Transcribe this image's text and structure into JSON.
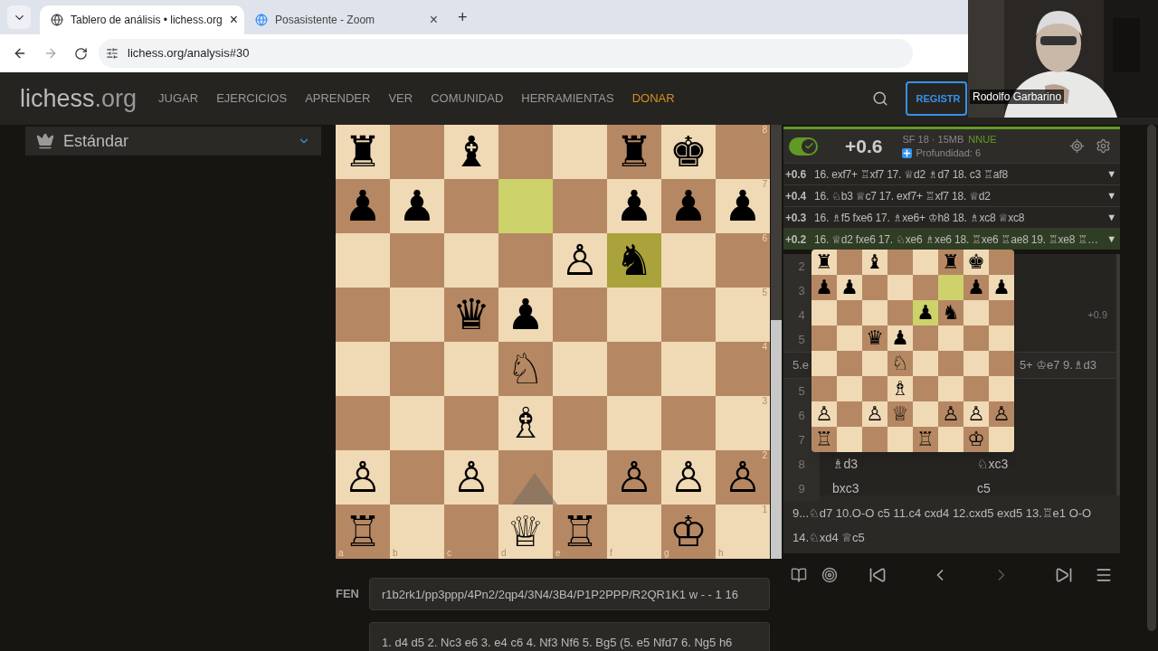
{
  "browser": {
    "tabs": [
      {
        "title": "Tablero de análisis • lichess.org",
        "selected": true,
        "close": "×"
      },
      {
        "title": "Posasistente - Zoom",
        "selected": false,
        "close": "×"
      }
    ],
    "new_tab": "+",
    "url": "lichess.org/analysis#30"
  },
  "header": {
    "logo": "lichess",
    "logo_suffix": ".org",
    "nav": [
      {
        "label": "JUGAR",
        "kind": "plain"
      },
      {
        "label": "EJERCICIOS",
        "kind": "plain"
      },
      {
        "label": "APRENDER",
        "kind": "plain"
      },
      {
        "label": "VER",
        "kind": "plain"
      },
      {
        "label": "COMUNIDAD",
        "kind": "plain"
      },
      {
        "label": "HERRAMIENTAS",
        "kind": "plain"
      },
      {
        "label": "DONAR",
        "kind": "highlight"
      }
    ],
    "register": "REGISTR"
  },
  "webcam": {
    "name": "Rodolfo Garbarino"
  },
  "variant": {
    "label": "Estándar"
  },
  "board": {
    "files": [
      "a",
      "b",
      "c",
      "d",
      "e",
      "f",
      "g",
      "h"
    ],
    "ranks": [
      {
        "label": "8",
        "squares": [
          {
            "piece": "♜",
            "highlight": false
          },
          {
            "highlight": false
          },
          {
            "piece": "♝",
            "highlight": false
          },
          {
            "highlight": false
          },
          {
            "highlight": false
          },
          {
            "piece": "♜",
            "highlight": false
          },
          {
            "piece": "♚",
            "highlight": false
          },
          {
            "highlight": false
          }
        ]
      },
      {
        "label": "7",
        "squares": [
          {
            "piece": "♟",
            "highlight": false
          },
          {
            "piece": "♟",
            "highlight": false
          },
          {
            "highlight": false
          },
          {
            "highlight": true
          },
          {
            "highlight": false
          },
          {
            "piece": "♟",
            "highlight": false
          },
          {
            "piece": "♟",
            "highlight": false
          },
          {
            "piece": "♟",
            "highlight": false
          }
        ]
      },
      {
        "label": "6",
        "squares": [
          {
            "highlight": false
          },
          {
            "highlight": false
          },
          {
            "highlight": false
          },
          {
            "highlight": false
          },
          {
            "piece": "♙",
            "highlight": false
          },
          {
            "piece": "♞",
            "highlight": true
          },
          {
            "highlight": false
          },
          {
            "highlight": false
          }
        ]
      },
      {
        "label": "5",
        "squares": [
          {
            "highlight": false
          },
          {
            "highlight": false
          },
          {
            "piece": "♛",
            "highlight": false
          },
          {
            "piece": "♟",
            "highlight": false
          },
          {
            "highlight": false
          },
          {
            "highlight": false
          },
          {
            "highlight": false
          },
          {
            "highlight": false
          }
        ]
      },
      {
        "label": "4",
        "squares": [
          {
            "highlight": false
          },
          {
            "highlight": false
          },
          {
            "highlight": false
          },
          {
            "piece": "♘",
            "highlight": false
          },
          {
            "highlight": false
          },
          {
            "highlight": false
          },
          {
            "highlight": false
          },
          {
            "highlight": false
          }
        ]
      },
      {
        "label": "3",
        "squares": [
          {
            "highlight": false
          },
          {
            "highlight": false
          },
          {
            "highlight": false
          },
          {
            "piece": "♗",
            "highlight": false
          },
          {
            "highlight": false
          },
          {
            "highlight": false
          },
          {
            "highlight": false
          },
          {
            "highlight": false
          }
        ]
      },
      {
        "label": "2",
        "squares": [
          {
            "piece": "♙",
            "highlight": false
          },
          {
            "highlight": false
          },
          {
            "piece": "♙",
            "highlight": false
          },
          {
            "highlight": false
          },
          {
            "highlight": false
          },
          {
            "piece": "♙",
            "highlight": false
          },
          {
            "piece": "♙",
            "highlight": false
          },
          {
            "piece": "♙",
            "highlight": false
          }
        ]
      },
      {
        "label": "1",
        "squares": [
          {
            "piece": "♖",
            "highlight": false
          },
          {
            "highlight": false
          },
          {
            "highlight": false
          },
          {
            "piece": "♕",
            "highlight": false
          },
          {
            "piece": "♖",
            "highlight": false
          },
          {
            "highlight": false
          },
          {
            "piece": "♔",
            "highlight": false
          },
          {
            "highlight": false
          }
        ]
      }
    ]
  },
  "eval_bar": {
    "level": 0.55
  },
  "fen": {
    "label": "FEN",
    "value": "r1b2rk1/pp3ppp/4Pn2/2qp4/3N4/3B4/P1P2PPP/R2QR1K1 w - - 1 16"
  },
  "pgn": {
    "value": "1. d4 d5 2. Nc3 e6 3. e4 c6 4. Nf3 Nf6 5. Bg5 (5. e5 Nfd7 6. Ng5 h6"
  },
  "engine": {
    "on": true,
    "eval": "+0.6",
    "name": "SF 18 · 15MB",
    "tag": "NNUE",
    "depth": "Profundidad: 6",
    "lines": [
      {
        "eval": "+0.6",
        "moves": "16. exf7+ ♖xf7 17. ♕d2 ♗d7 18. c3 ♖af8",
        "caret": "▼",
        "selected": false
      },
      {
        "eval": "+0.4",
        "moves": "16. ♘b3 ♕c7 17. exf7+ ♖xf7 18. ♕d2",
        "caret": "▼",
        "selected": false
      },
      {
        "eval": "+0.3",
        "moves": "16. ♗f5 fxe6 17. ♗xe6+ ♔h8 18. ♗xc8 ♕xc8",
        "caret": "▼",
        "selected": false
      },
      {
        "eval": "+0.2",
        "moves": "16. ♕d2 fxe6 17. ♘xe6 ♗xe6 18. ♖xe6 ♖ae8 19. ♖xe8 ♖…",
        "caret": "▼",
        "selected": true
      }
    ]
  },
  "moves": {
    "rows": [
      {
        "kind": "move",
        "number": "2"
      },
      {
        "kind": "move",
        "number": "3"
      },
      {
        "kind": "move",
        "number": "4",
        "eval": "+0.9"
      },
      {
        "kind": "move",
        "number": "5"
      },
      {
        "kind": "variation",
        "left": "5.e",
        "right": "5+ ♔e7 9.♗d3"
      },
      {
        "kind": "move",
        "number": "5"
      },
      {
        "kind": "move",
        "number": "6"
      },
      {
        "kind": "move",
        "number": "7"
      },
      {
        "kind": "move",
        "number": "8",
        "white": "♗d3",
        "black": "♘xc3"
      },
      {
        "kind": "move",
        "number": "9",
        "white": "bxc3",
        "black": "c5"
      }
    ],
    "variation": "9...♘d7 10.O-O c5 11.c4 cxd4 12.cxd5 exd5 13.♖e1 O-O 14.♘xd4 ♕c5"
  },
  "preview": {
    "ranks": [
      {
        "squares": [
          {
            "piece": "♜",
            "highlight": false
          },
          {
            "highlight": false
          },
          {
            "piece": "♝",
            "highlight": false
          },
          {
            "highlight": false
          },
          {
            "highlight": false
          },
          {
            "piece": "♜",
            "highlight": false
          },
          {
            "piece": "♚",
            "highlight": false
          },
          {
            "highlight": false
          }
        ]
      },
      {
        "squares": [
          {
            "piece": "♟",
            "highlight": false
          },
          {
            "piece": "♟",
            "highlight": false
          },
          {
            "highlight": false
          },
          {
            "highlight": false
          },
          {
            "highlight": false
          },
          {
            "highlight": true
          },
          {
            "piece": "♟",
            "highlight": false
          },
          {
            "piece": "♟",
            "highlight": false
          }
        ]
      },
      {
        "squares": [
          {
            "highlight": false
          },
          {
            "highlight": false
          },
          {
            "highlight": false
          },
          {
            "highlight": false
          },
          {
            "piece": "♟",
            "highlight": true
          },
          {
            "piece": "♞",
            "highlight": false
          },
          {
            "highlight": false
          },
          {
            "highlight": false
          }
        ]
      },
      {
        "squares": [
          {
            "highlight": false
          },
          {
            "highlight": false
          },
          {
            "piece": "♛",
            "highlight": false
          },
          {
            "piece": "♟",
            "highlight": false
          },
          {
            "highlight": false
          },
          {
            "highlight": false
          },
          {
            "highlight": false
          },
          {
            "highlight": false
          }
        ]
      },
      {
        "squares": [
          {
            "highlight": false
          },
          {
            "highlight": false
          },
          {
            "highlight": false
          },
          {
            "piece": "♘",
            "highlight": false
          },
          {
            "highlight": false
          },
          {
            "highlight": false
          },
          {
            "highlight": false
          },
          {
            "highlight": false
          }
        ]
      },
      {
        "squares": [
          {
            "highlight": false
          },
          {
            "highlight": false
          },
          {
            "highlight": false
          },
          {
            "piece": "♗",
            "highlight": false
          },
          {
            "highlight": false
          },
          {
            "highlight": false
          },
          {
            "highlight": false
          },
          {
            "highlight": false
          }
        ]
      },
      {
        "squares": [
          {
            "piece": "♙",
            "highlight": false
          },
          {
            "highlight": false
          },
          {
            "piece": "♙",
            "highlight": false
          },
          {
            "piece": "♕",
            "highlight": false
          },
          {
            "highlight": false
          },
          {
            "piece": "♙",
            "highlight": false
          },
          {
            "piece": "♙",
            "highlight": false
          },
          {
            "piece": "♙",
            "highlight": false
          }
        ]
      },
      {
        "squares": [
          {
            "piece": "♖",
            "highlight": false
          },
          {
            "highlight": false
          },
          {
            "highlight": false
          },
          {
            "highlight": false
          },
          {
            "piece": "♖",
            "highlight": false
          },
          {
            "highlight": false
          },
          {
            "piece": "♔",
            "highlight": false
          },
          {
            "highlight": false
          }
        ]
      }
    ]
  },
  "controls": [
    {
      "kind": "first",
      "disabled": false
    },
    {
      "kind": "prev",
      "disabled": false
    },
    {
      "kind": "next",
      "disabled": true
    },
    {
      "kind": "last",
      "disabled": false
    }
  ]
}
